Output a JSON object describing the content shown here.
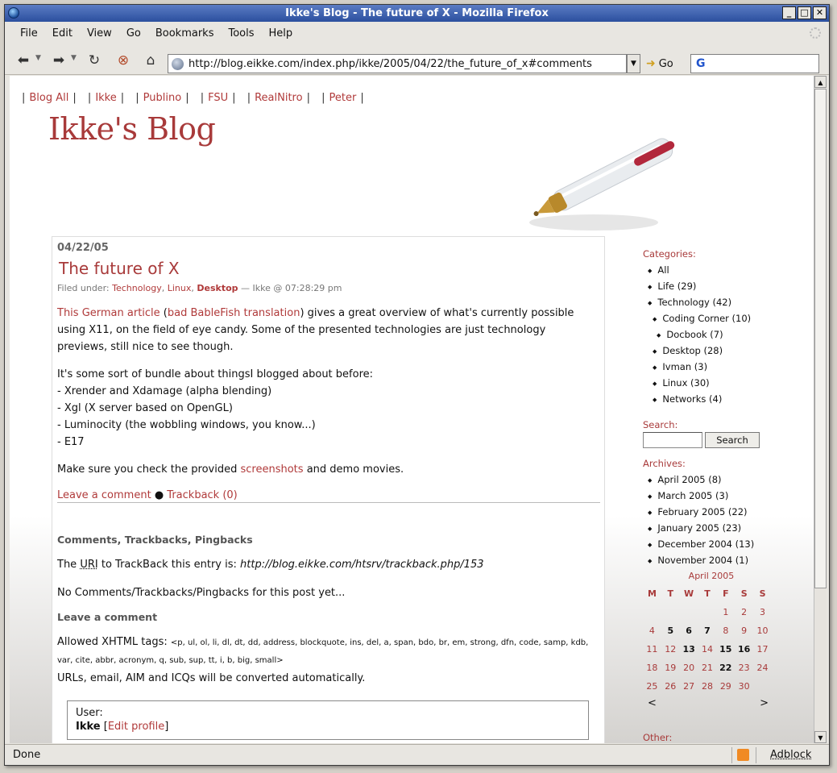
{
  "window": {
    "title": "Ikke's Blog - The future of X - Mozilla Firefox"
  },
  "menu": [
    "File",
    "Edit",
    "View",
    "Go",
    "Bookmarks",
    "Tools",
    "Help"
  ],
  "toolbar": {
    "url": "http://blog.eikke.com/index.php/ikke/2005/04/22/the_future_of_x#comments",
    "go_label": "Go",
    "search_engine_glyph": "G"
  },
  "topnav": [
    "Blog All",
    "Ikke",
    "Publino",
    "FSU",
    "RealNitro",
    "Peter"
  ],
  "blog_title": "Ikke's Blog",
  "post": {
    "date": "04/22/05",
    "title": "The future of X",
    "filed_label": "Filed under:",
    "categories": [
      "Technology",
      "Linux",
      "Desktop"
    ],
    "author_time": "— Ikke @ 07:28:29 pm",
    "intro_link1": "This German article",
    "intro_link2": "bad BableFish translation",
    "intro_text": "gives a great overview of what's currently possible using X11, on the field of eye candy. Some of the presented technologies are just technology previews, still nice to see though.",
    "bundle_intro": "It's some sort of bundle about thingsI blogged about before:",
    "bundle_items": [
      "- Xrender and Xdamage (alpha blending)",
      "- Xgl (X server based on OpenGL)",
      "- Luminocity (the wobbling windows, you know...)",
      "- E17"
    ],
    "check_pre": "Make sure you check the provided",
    "check_link": "screenshots",
    "check_post": "and demo movies.",
    "leave_comment": "Leave a comment",
    "trackback": "Trackback (0)"
  },
  "comments": {
    "heading": "Comments, Trackbacks, Pingbacks",
    "uri_pre": "The",
    "uri_abbr": "URI",
    "uri_mid": "to TrackBack this entry is:",
    "uri_value": "http://blog.eikke.com/htsrv/trackback.php/153",
    "none": "No Comments/Trackbacks/Pingbacks for this post yet...",
    "leave_heading": "Leave a comment",
    "allowed_label": "Allowed XHTML tags:",
    "allowed_tags": "<p, ul, ol, li, dl, dt, dd, address, blockquote, ins, del, a, span, bdo, br, em, strong, dfn, code, samp, kdb, var, cite, abbr, acronym, q, sub, sup, tt, i, b, big, small>",
    "auto_convert": "URLs, email, AIM and ICQs will be converted automatically.",
    "user_label": "User:",
    "user_name": "Ikke",
    "edit_profile": "Edit profile"
  },
  "sidebar": {
    "categories_title": "Categories:",
    "categories": [
      {
        "label": "All",
        "indent": 0
      },
      {
        "label": "Life (29)",
        "indent": 0
      },
      {
        "label": "Technology (42)",
        "indent": 0
      },
      {
        "label": "Coding Corner (10)",
        "indent": 1
      },
      {
        "label": "Docbook (7)",
        "indent": 2
      },
      {
        "label": "Desktop (28)",
        "indent": 1
      },
      {
        "label": "Ivman (3)",
        "indent": 1
      },
      {
        "label": "Linux (30)",
        "indent": 1
      },
      {
        "label": "Networks (4)",
        "indent": 1
      }
    ],
    "search_title": "Search:",
    "search_button": "Search",
    "archives_title": "Archives:",
    "archives": [
      "April 2005 (8)",
      "March 2005 (3)",
      "February 2005 (22)",
      "January 2005 (23)",
      "December 2004 (13)",
      "November 2004 (1)"
    ],
    "calendar": {
      "caption": "April 2005",
      "weekdays": [
        "M",
        "T",
        "W",
        "T",
        "F",
        "S",
        "S"
      ],
      "weeks": [
        [
          "",
          "",
          "",
          "",
          "1",
          "2",
          "3"
        ],
        [
          "4",
          "5",
          "6",
          "7",
          "8",
          "9",
          "10"
        ],
        [
          "11",
          "12",
          "13",
          "14",
          "15",
          "16",
          "17"
        ],
        [
          "18",
          "19",
          "20",
          "21",
          "22",
          "23",
          "24"
        ],
        [
          "25",
          "26",
          "27",
          "28",
          "29",
          "30",
          ""
        ]
      ],
      "bold_days": [
        "5",
        "6",
        "7",
        "13",
        "15",
        "16",
        "22"
      ],
      "prev": "<",
      "next": ">"
    },
    "other_title": "Other:"
  },
  "status": {
    "text": "Done",
    "adblock": "Adblock"
  }
}
